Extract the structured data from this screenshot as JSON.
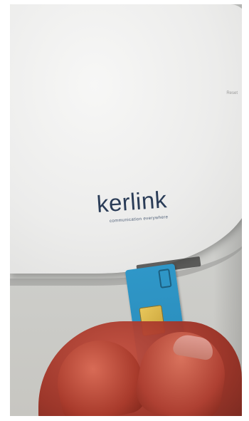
{
  "brand": {
    "logo_text": "kerlink",
    "tagline": "communication everywhere"
  },
  "device": {
    "small_mark": "Reset"
  },
  "sim_card": {
    "chip_color": "#d8b44a",
    "card_color": "#2f97c8"
  },
  "colors": {
    "logo": "#2a3c57",
    "router_body": "#efefee"
  }
}
